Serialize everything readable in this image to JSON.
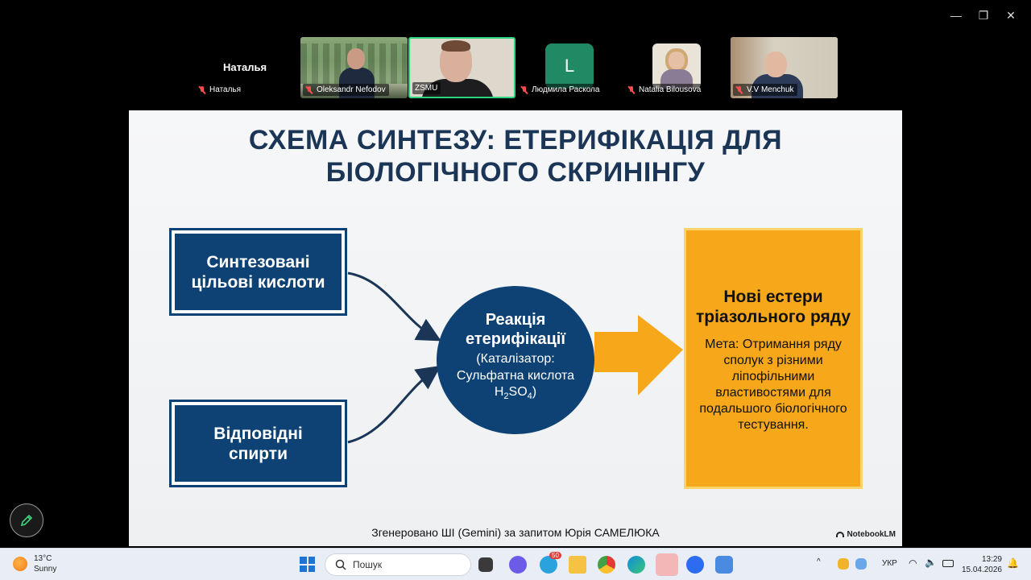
{
  "window": {
    "minimize": "—",
    "maximize": "❐",
    "close": "✕"
  },
  "participants": [
    {
      "name": "Наталья",
      "big_name": "Наталья"
    },
    {
      "name": "Oleksandr Nefodov"
    },
    {
      "name": "ZSMU"
    },
    {
      "name": "Людмила Раскола",
      "initial": "L"
    },
    {
      "name": "Natalia Bilousova"
    },
    {
      "name": "V.V Menchuk"
    }
  ],
  "slide": {
    "title_line1": "СХЕМА СИНТЕЗУ: ЕТЕРИФІКАЦІЯ ДЛЯ",
    "title_line2": "БІОЛОГІЧНОГО СКРИНІНГУ",
    "box_acids": [
      "Синтезовані",
      "цільові кислоти"
    ],
    "box_alcohols": [
      "Відповідні",
      "спирти"
    ],
    "circle": {
      "title_line1": "Реакція",
      "title_line2": "етерифікації",
      "catalyst_line1": "(Каталізатор:",
      "catalyst_line2": "Сульфатна кислота",
      "formula_h": "H",
      "formula_sub1": "2",
      "formula_so": "SO",
      "formula_sub2": "4",
      "formula_close": ")"
    },
    "result": {
      "title_line1": "Нові естери",
      "title_line2": "тріазольного ряду",
      "desc": "Мета: Отримання ряду сполук з різними ліпофільними властивостями для подальшого біологічного тестування."
    },
    "footer": "Згенеровано ШІ (Gemini) за запитом Юрія САМЕЛЮКА",
    "brand": "NotebookLM",
    "colors": {
      "navy": "#0e4275",
      "orange": "#f6a81a",
      "title": "#1b3557"
    }
  },
  "taskbar": {
    "temperature": "13°C",
    "weather": "Sunny",
    "search_placeholder": "Пошук",
    "telegram_badge": "50",
    "language": "УКР",
    "time": "13:29",
    "date": "15.04.2026"
  }
}
